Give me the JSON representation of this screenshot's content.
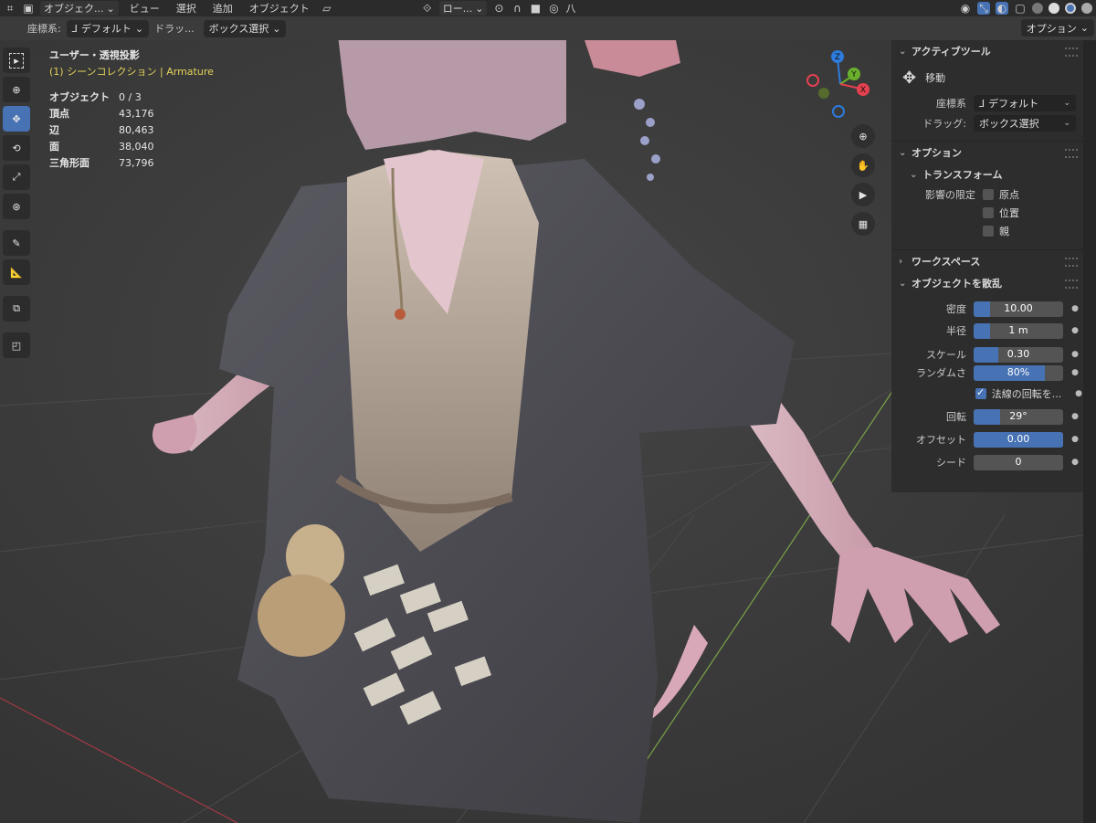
{
  "topbar": {
    "mode_dropdown": "オブジェク...",
    "menus": [
      "ビュー",
      "選択",
      "追加",
      "オブジェクト"
    ],
    "pivot_dropdown": "ロー...",
    "snap_label": "八"
  },
  "header": {
    "coord_label": "座標系:",
    "coord_value": "デフォルト",
    "drag_label": "ドラッ...",
    "drag_value": "ボックス選択",
    "options_button": "オプション"
  },
  "stats": {
    "view_title": "ユーザー・透視投影",
    "collection": "(1) シーンコレクション | Armature",
    "rows": [
      {
        "k": "オブジェクト",
        "v": "0 / 3"
      },
      {
        "k": "頂点",
        "v": "43,176"
      },
      {
        "k": "辺",
        "v": "80,463"
      },
      {
        "k": "面",
        "v": "38,040"
      },
      {
        "k": "三角形面",
        "v": "73,796"
      }
    ]
  },
  "gizmo": {
    "z": "Z",
    "y": "Y",
    "x": "X"
  },
  "panel": {
    "active_tool_header": "アクティブツール",
    "tool_name": "移動",
    "coord_label": "座標系",
    "coord_value": "デフォルト",
    "drag_label": "ドラッグ:",
    "drag_value": "ボックス選択",
    "options_header": "オプション",
    "transform_header": "トランスフォーム",
    "affect_label": "影響の限定",
    "affect_items": [
      "原点",
      "位置",
      "親"
    ],
    "workspace_header": "ワークスペース",
    "scatter_header": "オブジェクトを散乱",
    "density_label": "密度",
    "density_value": "10.00",
    "density_fill": 0.18,
    "radius_label": "半径",
    "radius_value": "1 m",
    "radius_fill": 0.18,
    "scale_label": "スケール",
    "scale_value": "0.30",
    "scale_fill": 0.28,
    "random_label": "ランダムさ",
    "random_value": "80%",
    "random_fill": 0.8,
    "normal_rot_label": "法線の回転を...",
    "rotation_label": "回転",
    "rotation_value": "29°",
    "rotation_fill": 0.3,
    "offset_label": "オフセット",
    "offset_value": "0.00",
    "offset_fill": 1.0,
    "seed_label": "シード",
    "seed_value": "0",
    "seed_fill": 0
  },
  "colors": {
    "accent": "#4772b3",
    "collection": "#e5d35a",
    "x_axis": "#e4414f",
    "y_axis": "#6ab02c",
    "z_axis": "#2d7bdc"
  }
}
